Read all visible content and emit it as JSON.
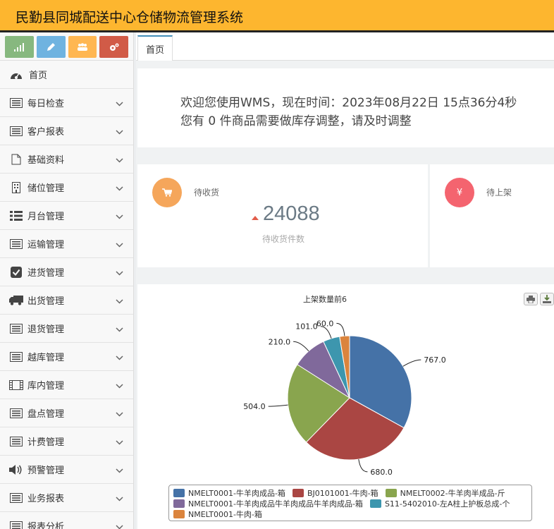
{
  "app": {
    "title": "民勤县同城配送中心仓储物流管理系统"
  },
  "shortcuts": [
    {
      "icon": "signal-icon",
      "color": "#87b87f"
    },
    {
      "icon": "pencil-icon",
      "color": "#6fb3e0"
    },
    {
      "icon": "users-icon",
      "color": "#ffb752"
    },
    {
      "icon": "cogs-icon",
      "color": "#d15b47"
    }
  ],
  "sidebar": {
    "home": {
      "label": "首页",
      "icon": "dashboard-icon"
    },
    "items": [
      {
        "label": "每日检查",
        "icon": "list-alt-icon"
      },
      {
        "label": "客户报表",
        "icon": "list-alt-icon"
      },
      {
        "label": "基础资料",
        "icon": "file-icon"
      },
      {
        "label": "储位管理",
        "icon": "building-icon"
      },
      {
        "label": "月台管理",
        "icon": "th-list-icon"
      },
      {
        "label": "运输管理",
        "icon": "list-alt-icon"
      },
      {
        "label": "进货管理",
        "icon": "check-square-icon"
      },
      {
        "label": "出货管理",
        "icon": "truck-icon"
      },
      {
        "label": "退货管理",
        "icon": "list-alt-icon"
      },
      {
        "label": "越库管理",
        "icon": "list-alt-icon"
      },
      {
        "label": "库内管理",
        "icon": "film-icon"
      },
      {
        "label": "盘点管理",
        "icon": "list-alt-icon"
      },
      {
        "label": "计费管理",
        "icon": "list-alt-icon"
      },
      {
        "label": "预警管理",
        "icon": "volume-up-icon"
      },
      {
        "label": "业务报表",
        "icon": "list-alt-icon"
      },
      {
        "label": "报表分析",
        "icon": "list-alt-icon"
      }
    ]
  },
  "tabs": [
    {
      "label": "首页"
    }
  ],
  "welcome": {
    "line1": "欢迎您使用WMS，现在时间：2023年08月22日 15点36分4秒",
    "line2": "您有 0 件商品需要做库存调整，请及时调整"
  },
  "cards": [
    {
      "label": "待收货",
      "icon": "cart-icon",
      "color": "#f5a65b",
      "value": "24088",
      "sub": "待收货件数"
    },
    {
      "label": "待上架",
      "icon": "yen-icon",
      "color": "#f4646f"
    }
  ],
  "chart_data": {
    "type": "pie",
    "title": "上架数量前6",
    "slices": [
      {
        "name": "NMELT0001-牛羊肉成品-箱",
        "value": 767.0,
        "label": "767.0",
        "color": "#4572a7"
      },
      {
        "name": "BJ0101001-牛肉-箱",
        "value": 680.0,
        "label": "680.0",
        "color": "#aa4643"
      },
      {
        "name": "NMELT0002-牛羊肉半成品-斤",
        "value": 504.0,
        "label": "504.0",
        "color": "#89a54e"
      },
      {
        "name": "NMELT0001-牛羊肉成品牛羊肉成品牛羊肉成品-箱",
        "value": 210.0,
        "label": "210.0",
        "color": "#80699b"
      },
      {
        "name": "S11-5402010-左A柱上护板总成-个",
        "value": 101.0,
        "label": "101.0",
        "color": "#3d96ae"
      },
      {
        "name": "NMELT0001-牛肉-箱",
        "value": 60.0,
        "label": "60.0",
        "color": "#db843d"
      }
    ],
    "legend": "bottom"
  }
}
